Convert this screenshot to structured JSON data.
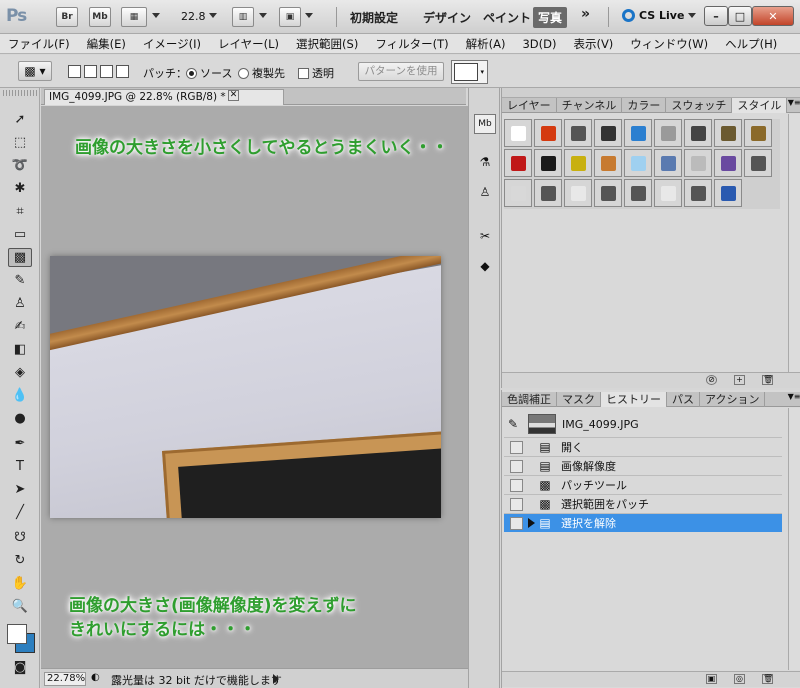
{
  "appbar": {
    "logo": "Ps",
    "br_label": "Br",
    "mb_label": "Mb",
    "zoom": "22.8",
    "workspaces": [
      "初期設定",
      "デザイン",
      "ペイント",
      "写真"
    ],
    "more": "»",
    "cs_live": "CS Live",
    "accent_color": "#1a74c7"
  },
  "menu": [
    "ファイル(F)",
    "編集(E)",
    "イメージ(I)",
    "レイヤー(L)",
    "選択範囲(S)",
    "フィルター(T)",
    "解析(A)",
    "3D(D)",
    "表示(V)",
    "ウィンドウ(W)",
    "ヘルプ(H)"
  ],
  "options": {
    "patch_label": "パッチ：",
    "source_label": "ソース",
    "dest_label": "複製先",
    "transparent_label": "透明",
    "use_pattern_label": "パターンを使用",
    "selected": "source"
  },
  "document": {
    "tab_title": "IMG_4099.JPG @ 22.8% (RGB/8) *",
    "annotation_top": "画像の大きさを小さくしてやるとうまくいく・・",
    "annotation_bottom_line1": "画像の大きさ(画像解像度)を変えずに",
    "annotation_bottom_line2": "きれいにするには・・・",
    "annotation_color": "#2f9e2f"
  },
  "status": {
    "zoom": "22.78%",
    "message": "露光量は 32 bit だけで機能します"
  },
  "styles_panel": {
    "tabs": [
      "レイヤー",
      "チャンネル",
      "カラー",
      "スウォッチ",
      "スタイル"
    ],
    "active_tab": "スタイル",
    "swatches": [
      "#ffffff",
      "#d43a10",
      "#555555",
      "#333333",
      "#2b7fd0",
      "#9a9a9a",
      "#444444",
      "#6b5a30",
      "#8b6a2a",
      "#c01818",
      "#1a1a1a",
      "#c8b010",
      "#c77a30",
      "#9fd0f0",
      "#5a7ab0",
      "#bbbbbb",
      "#6a4aa0",
      "#555555",
      "#d8d8d8",
      "#555555",
      "#e8e8e8",
      "#555555",
      "#555555",
      "#e8e8e8",
      "#555555",
      "#2a5ab0"
    ]
  },
  "history_panel": {
    "tabs": [
      "色調補正",
      "マスク",
      "ヒストリー",
      "パス",
      "アクション"
    ],
    "active_tab": "ヒストリー",
    "snapshot_name": "IMG_4099.JPG",
    "items": [
      "開く",
      "画像解像度",
      "パッチツール",
      "選択範囲をパッチ",
      "選択を解除"
    ],
    "selected_index": 4,
    "selection_color": "#3c91e6"
  }
}
